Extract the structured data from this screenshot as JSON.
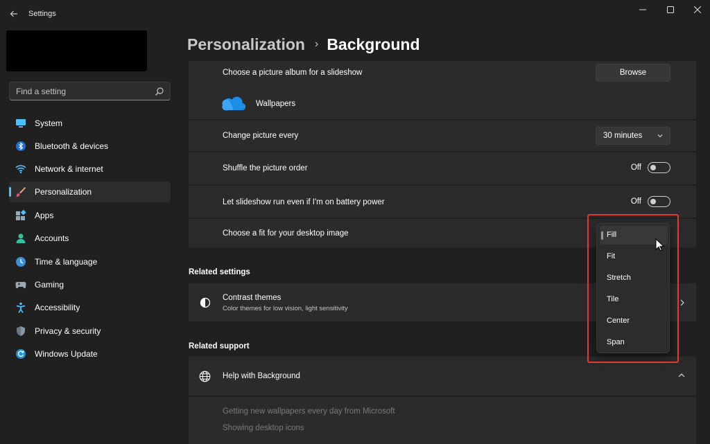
{
  "window": {
    "title": "Settings"
  },
  "sidebar": {
    "search_placeholder": "Find a setting",
    "items": [
      {
        "label": "System",
        "icon": "system-icon"
      },
      {
        "label": "Bluetooth & devices",
        "icon": "bluetooth-icon"
      },
      {
        "label": "Network & internet",
        "icon": "wifi-icon"
      },
      {
        "label": "Personalization",
        "icon": "brush-icon",
        "selected": true
      },
      {
        "label": "Apps",
        "icon": "apps-icon"
      },
      {
        "label": "Accounts",
        "icon": "person-icon"
      },
      {
        "label": "Time & language",
        "icon": "globe-clock-icon"
      },
      {
        "label": "Gaming",
        "icon": "gamepad-icon"
      },
      {
        "label": "Accessibility",
        "icon": "accessibility-icon"
      },
      {
        "label": "Privacy & security",
        "icon": "shield-icon"
      },
      {
        "label": "Windows Update",
        "icon": "update-icon"
      }
    ]
  },
  "breadcrumb": {
    "parent": "Personalization",
    "separator": "›",
    "current": "Background"
  },
  "settings": {
    "album": {
      "label": "Choose a picture album for a slideshow",
      "button": "Browse"
    },
    "folder": {
      "name": "Wallpapers",
      "icon": "onedrive-cloud-icon"
    },
    "interval": {
      "label": "Change picture every",
      "value": "30 minutes"
    },
    "shuffle": {
      "label": "Shuffle the picture order",
      "state": "Off"
    },
    "battery": {
      "label": "Let slideshow run even if I'm on battery power",
      "state": "Off"
    },
    "fit": {
      "label": "Choose a fit for your desktop image"
    }
  },
  "fit_dropdown": {
    "options": [
      "Fill",
      "Fit",
      "Stretch",
      "Tile",
      "Center",
      "Span"
    ],
    "selected": "Fill"
  },
  "related_settings": {
    "title": "Related settings",
    "contrast": {
      "title": "Contrast themes",
      "subtitle": "Color themes for low vision, light sensitivity"
    }
  },
  "related_support": {
    "title": "Related support",
    "help": {
      "title": "Help with Background"
    },
    "links": [
      "Getting new wallpapers every day from Microsoft",
      "Showing desktop icons"
    ]
  },
  "colors": {
    "accent": "#4cc2ff",
    "background": "#202020",
    "card": "#2b2b2b",
    "highlight": "#e53935"
  }
}
